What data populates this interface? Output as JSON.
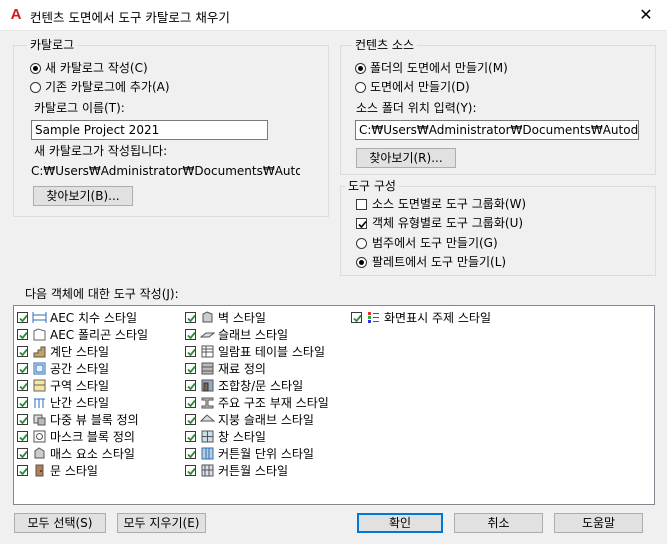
{
  "window": {
    "title": "컨텐츠 도면에서 도구 카탈로그 채우기",
    "close_glyph": "✕",
    "app_icon_letter": "A"
  },
  "catalog": {
    "legend": "카탈로그",
    "option_new": "새 카탈로그 작성(C)",
    "option_existing": "기존 카탈로그에 추가(A)",
    "name_label": "카탈로그 이름(T):",
    "name_value": "Sample Project 2021",
    "created_label": "새 카탈로그가 작성됩니다:",
    "created_path": "C:₩Users₩Administrator₩Documents₩Autodesk",
    "browse_label": "찾아보기(B)..."
  },
  "source": {
    "legend": "컨텐츠 소스",
    "option_folder": "폴더의 도면에서 만들기(M)",
    "option_drawing": "도면에서 만들기(D)",
    "folder_label": "소스 폴더 위치 입력(Y):",
    "folder_value": "C:₩Users₩Administrator₩Documents₩Autodesk",
    "browse_label": "찾아보기(R)..."
  },
  "tool_org": {
    "legend": "도구 구성",
    "by_drawing": "소스 도면별로 도구 그룹화(W)",
    "by_type": "객체 유형별로 도구 그룹화(U)",
    "from_category": "범주에서 도구 만들기(G)",
    "from_palette": "팔레트에서 도구 만들기(L)"
  },
  "objects": {
    "label": "다음 객체에 대한 도구 작성(J):",
    "col1": [
      {
        "label": "AEC 치수 스타일",
        "icon": "dimension-icon"
      },
      {
        "label": "AEC 폴리곤 스타일",
        "icon": "polygon-icon"
      },
      {
        "label": "계단 스타일",
        "icon": "stair-icon"
      },
      {
        "label": "공간 스타일",
        "icon": "space-icon"
      },
      {
        "label": "구역 스타일",
        "icon": "zone-icon"
      },
      {
        "label": "난간 스타일",
        "icon": "railing-icon"
      },
      {
        "label": "다중 뷰 블록 정의",
        "icon": "multiview-block-icon"
      },
      {
        "label": "마스크 블록 정의",
        "icon": "mask-block-icon"
      },
      {
        "label": "매스 요소 스타일",
        "icon": "mass-element-icon"
      },
      {
        "label": "문 스타일",
        "icon": "door-icon"
      }
    ],
    "col2": [
      {
        "label": "벽 스타일",
        "icon": "wall-icon"
      },
      {
        "label": "슬래브 스타일",
        "icon": "slab-icon"
      },
      {
        "label": "일람표 테이블 스타일",
        "icon": "schedule-table-icon"
      },
      {
        "label": "재료 정의",
        "icon": "material-icon"
      },
      {
        "label": "조합창/문 스타일",
        "icon": "door-window-assembly-icon"
      },
      {
        "label": "주요 구조 부재 스타일",
        "icon": "structural-member-icon"
      },
      {
        "label": "지붕 슬래브 스타일",
        "icon": "roof-slab-icon"
      },
      {
        "label": "창 스타일",
        "icon": "window-icon"
      },
      {
        "label": "커튼월 단위 스타일",
        "icon": "curtain-wall-unit-icon"
      },
      {
        "label": "커튼월 스타일",
        "icon": "curtain-wall-icon"
      }
    ],
    "col3": [
      {
        "label": "화면표시 주제 스타일",
        "icon": "display-theme-icon"
      }
    ]
  },
  "buttons": {
    "select_all": "모두 선택(S)",
    "clear_all": "모두 지우기(E)",
    "ok": "확인",
    "cancel": "취소",
    "help": "도움말"
  },
  "colors": {
    "check_green": "#2f8a3b",
    "accent_blue": "#0078d7",
    "app_red": "#d01c1c"
  }
}
